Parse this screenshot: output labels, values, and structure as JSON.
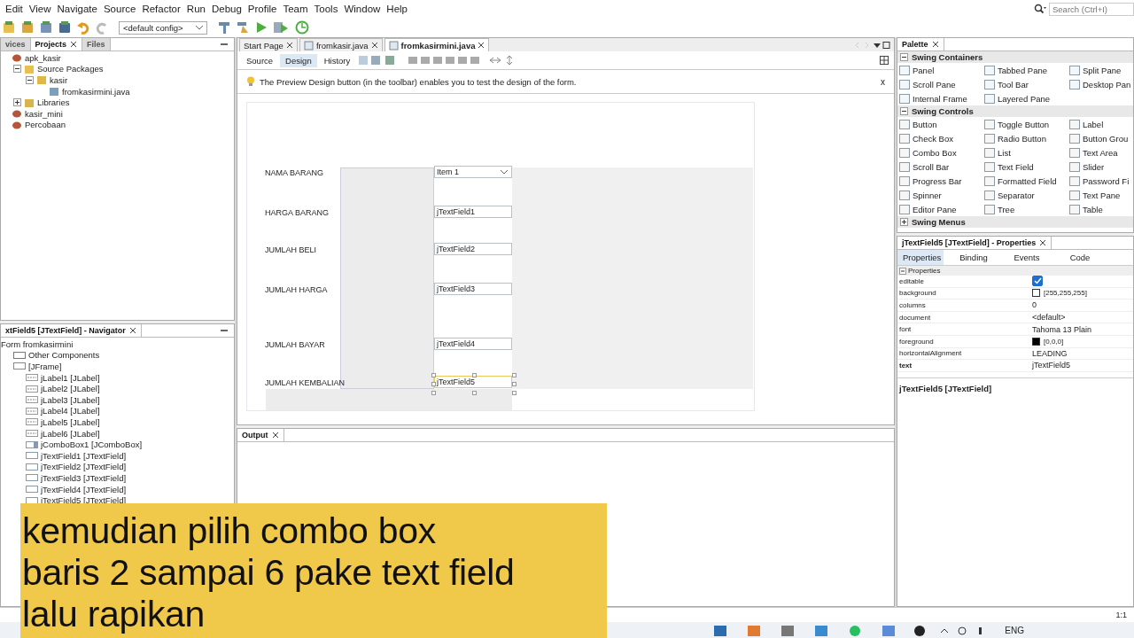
{
  "menu": [
    "Edit",
    "View",
    "Navigate",
    "Source",
    "Refactor",
    "Run",
    "Debug",
    "Profile",
    "Team",
    "Tools",
    "Window",
    "Help"
  ],
  "toolbar": {
    "config": "<default config>"
  },
  "search": {
    "placeholder": "Search (Ctrl+I)"
  },
  "projects_panel": {
    "tabs": [
      {
        "label": "vices",
        "selected": false,
        "closable": false
      },
      {
        "label": "Projects",
        "selected": true,
        "closable": true
      },
      {
        "label": "Files",
        "selected": false,
        "closable": false
      }
    ],
    "tree": [
      {
        "label": "apk_kasir",
        "kind": "project",
        "children": [
          {
            "label": "Source Packages",
            "kind": "folder",
            "expanded": true,
            "children": [
              {
                "label": "kasir",
                "kind": "package",
                "expanded": true,
                "children": [
                  {
                    "label": "fromkasirmini.java",
                    "kind": "file"
                  }
                ]
              }
            ]
          },
          {
            "label": "Libraries",
            "kind": "library",
            "expanded": false
          }
        ]
      },
      {
        "label": "kasir_mini",
        "kind": "project"
      },
      {
        "label": "Percobaan",
        "kind": "project"
      }
    ]
  },
  "navigator": {
    "title": "xtField5 [JTextField] - Navigator",
    "tree": [
      {
        "label": "Form fromkasirmini",
        "kind": "plain",
        "children": [
          {
            "label": "Other Components",
            "kind": "components"
          },
          {
            "label": "[JFrame]",
            "kind": "frame",
            "children": [
              {
                "label": "jLabel1 [JLabel]",
                "kind": "label"
              },
              {
                "label": "jLabel2 [JLabel]",
                "kind": "label"
              },
              {
                "label": "jLabel3 [JLabel]",
                "kind": "label"
              },
              {
                "label": "jLabel4 [JLabel]",
                "kind": "label"
              },
              {
                "label": "jLabel5 [JLabel]",
                "kind": "label"
              },
              {
                "label": "jLabel6 [JLabel]",
                "kind": "label"
              },
              {
                "label": "jComboBox1 [JComboBox]",
                "kind": "combo"
              },
              {
                "label": "jTextField1 [JTextField]",
                "kind": "textfield"
              },
              {
                "label": "jTextField2 [JTextField]",
                "kind": "textfield"
              },
              {
                "label": "jTextField3 [JTextField]",
                "kind": "textfield"
              },
              {
                "label": "jTextField4 [JTextField]",
                "kind": "textfield"
              },
              {
                "label": "jTextField5 [JTextField]",
                "kind": "textfield"
              }
            ]
          }
        ]
      }
    ]
  },
  "editor": {
    "tabs": [
      {
        "label": "Start Page",
        "selected": false
      },
      {
        "label": "fromkasir.java",
        "selected": false
      },
      {
        "label": "fromkasirmini.java",
        "selected": true
      }
    ],
    "views": [
      {
        "label": "Source",
        "selected": false
      },
      {
        "label": "Design",
        "selected": true
      },
      {
        "label": "History",
        "selected": false
      }
    ],
    "hint": "The Preview Design button (in the toolbar) enables you to test the design of the form.",
    "hint_close": "x",
    "form": [
      {
        "label": "NAMA BARANG",
        "kind": "combo",
        "value": "Item 1",
        "selected": false
      },
      {
        "label": "HARGA BARANG",
        "kind": "textfield",
        "value": "jTextField1",
        "selected": false
      },
      {
        "label": "JUMLAH BELI",
        "kind": "textfield",
        "value": "jTextField2",
        "selected": false
      },
      {
        "label": "JUMLAH HARGA",
        "kind": "textfield",
        "value": "jTextField3",
        "selected": false
      },
      {
        "label": "JUMLAH BAYAR",
        "kind": "textfield",
        "value": "jTextField4",
        "selected": false
      },
      {
        "label": "JUMLAH KEMBALIAN",
        "kind": "textfield",
        "value": "jTextField5",
        "selected": true
      }
    ]
  },
  "output": {
    "title": "Output"
  },
  "palette": {
    "title": "Palette",
    "sections": [
      {
        "title": "Swing Containers",
        "expanded": true,
        "items": [
          "Panel",
          "Tabbed Pane",
          "Split Pane",
          "Scroll Pane",
          "Tool Bar",
          "Desktop Pan",
          "Internal Frame",
          "Layered Pane"
        ]
      },
      {
        "title": "Swing Controls",
        "expanded": true,
        "items": [
          "Button",
          "Toggle Button",
          "Label",
          "Check Box",
          "Radio Button",
          "Button Grou",
          "Combo Box",
          "List",
          "Text Area",
          "Scroll Bar",
          "Text Field",
          "Slider",
          "Progress Bar",
          "Formatted Field",
          "Password Fi",
          "Spinner",
          "Separator",
          "Text Pane",
          "Editor Pane",
          "Tree",
          "Table"
        ]
      },
      {
        "title": "Swing Menus",
        "expanded": false
      }
    ]
  },
  "properties": {
    "title": "jTextField5 [JTextField] - Properties",
    "tabs": [
      {
        "label": "Properties",
        "selected": true
      },
      {
        "label": "Binding",
        "selected": false
      },
      {
        "label": "Events",
        "selected": false
      },
      {
        "label": "Code",
        "selected": false
      }
    ],
    "section": "Properties",
    "rows": [
      {
        "name": "editable",
        "kind": "checkbox",
        "checked": true
      },
      {
        "name": "background",
        "kind": "color",
        "color": "#ffffff",
        "value": "[255,255,255]"
      },
      {
        "name": "columns",
        "kind": "text",
        "value": "0"
      },
      {
        "name": "document",
        "kind": "text",
        "value": "<default>"
      },
      {
        "name": "font",
        "kind": "text",
        "value": "Tahoma 13 Plain"
      },
      {
        "name": "foreground",
        "kind": "color",
        "color": "#000000",
        "value": "[0,0,0]"
      },
      {
        "name": "horizontalAlignment",
        "kind": "text",
        "value": "LEADING"
      },
      {
        "name": "text",
        "kind": "text",
        "value": "jTextField5",
        "bold": true
      }
    ],
    "footer": "jTextField5 [JTextField]"
  },
  "status_bar": {
    "position": "1:1"
  },
  "taskbar": {
    "language": "ENG"
  },
  "caption": [
    "kemudian pilih combo box",
    "baris 2 sampai 6 pake text field",
    "lalu rapikan"
  ]
}
